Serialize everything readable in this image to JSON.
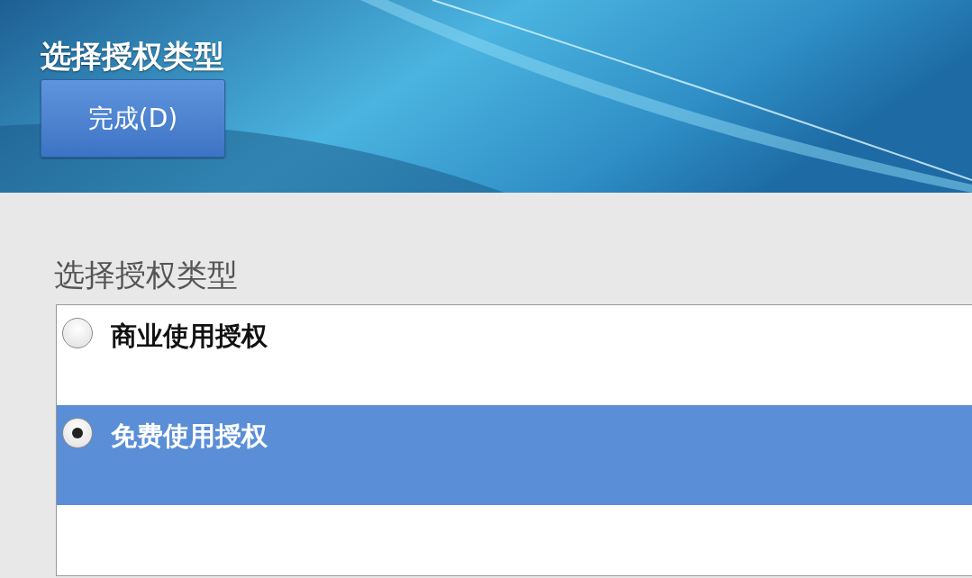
{
  "header": {
    "title": "选择授权类型",
    "done_button": "完成(D)"
  },
  "section_label": "选择授权类型",
  "license_options": [
    {
      "label": "商业使用授权",
      "selected": false
    },
    {
      "label": "免费使用授权",
      "selected": true
    }
  ]
}
